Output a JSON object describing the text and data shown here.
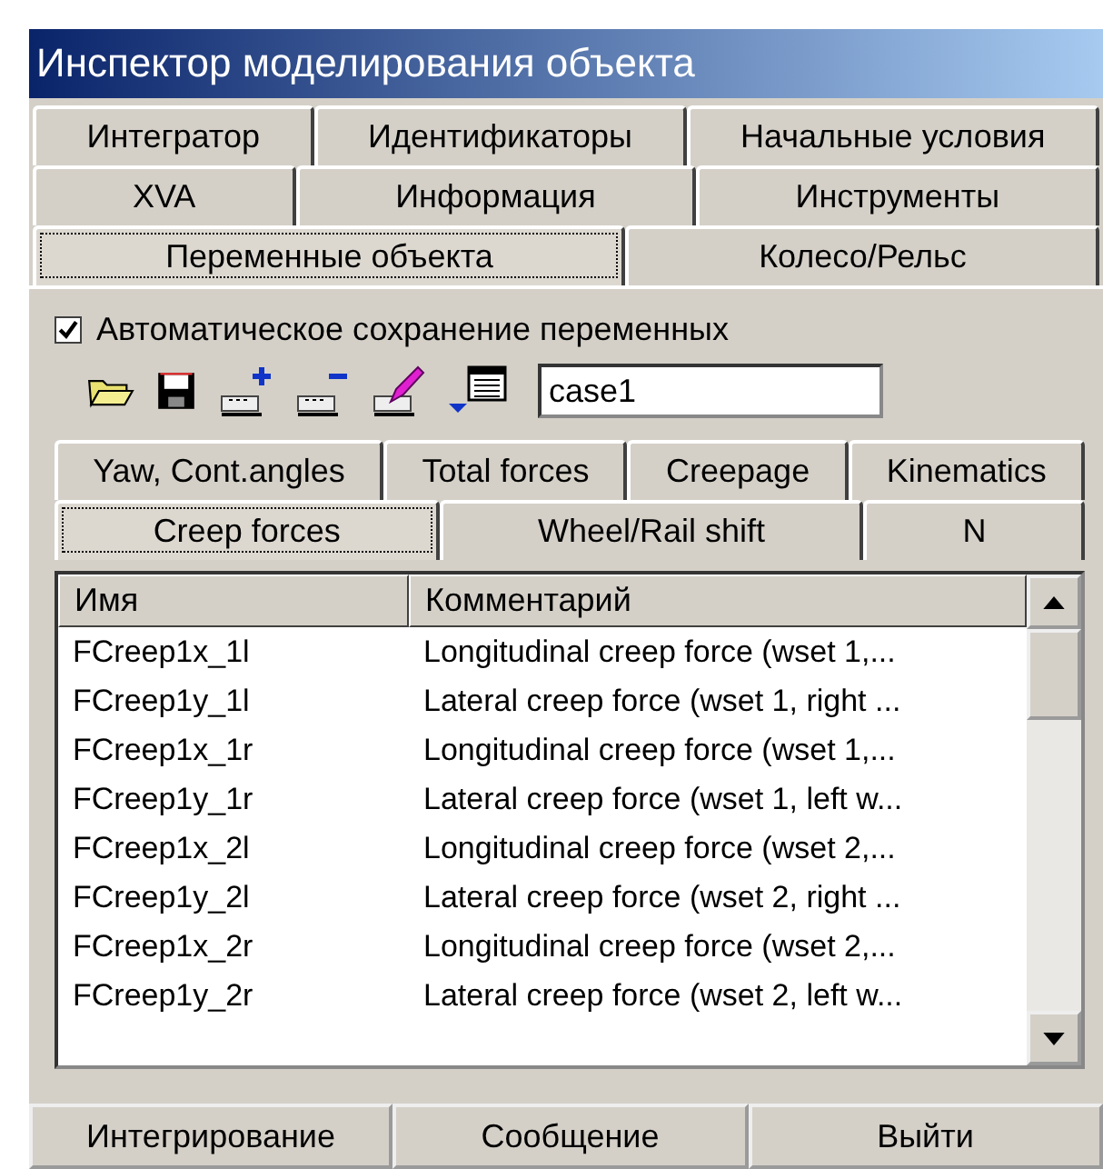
{
  "window": {
    "title": "Инспектор моделирования объекта"
  },
  "tab_rows": [
    [
      {
        "label": "Интегратор",
        "selected": false
      },
      {
        "label": "Идентификаторы",
        "selected": false
      },
      {
        "label": "Начальные условия",
        "selected": false
      }
    ],
    [
      {
        "label": "XVA",
        "selected": false
      },
      {
        "label": "Информация",
        "selected": false
      },
      {
        "label": "Инструменты",
        "selected": false
      }
    ],
    [
      {
        "label": "Переменные объекта",
        "selected": true
      },
      {
        "label": "Колесо/Рельс",
        "selected": false
      }
    ]
  ],
  "autosave": {
    "label": "Автоматическое сохранение переменных",
    "checked": true
  },
  "toolbar": {
    "buttons": [
      {
        "kind": "open"
      },
      {
        "kind": "save"
      },
      {
        "kind": "add"
      },
      {
        "kind": "remove"
      },
      {
        "kind": "edit"
      },
      {
        "kind": "list"
      }
    ],
    "name_field": {
      "value": "case1"
    }
  },
  "inner_tab_rows": [
    [
      {
        "label": "Yaw, Cont.angles",
        "selected": false
      },
      {
        "label": "Total forces",
        "selected": false
      },
      {
        "label": "Creepage",
        "selected": false
      },
      {
        "label": "Kinematics",
        "selected": false
      }
    ],
    [
      {
        "label": "Creep forces",
        "selected": true
      },
      {
        "label": "Wheel/Rail shift",
        "selected": false
      },
      {
        "label": "N",
        "selected": false
      }
    ]
  ],
  "table": {
    "columns": [
      "Имя",
      "Комментарий"
    ],
    "rows": [
      [
        "FCreep1x_1l",
        "Longitudinal creep force (wset 1,..."
      ],
      [
        "FCreep1y_1l",
        "Lateral creep force (wset 1, right ..."
      ],
      [
        "FCreep1x_1r",
        "Longitudinal creep force (wset 1,..."
      ],
      [
        "FCreep1y_1r",
        "Lateral creep force (wset 1, left w..."
      ],
      [
        "FCreep1x_2l",
        "Longitudinal creep force (wset 2,..."
      ],
      [
        "FCreep1y_2l",
        "Lateral creep force (wset 2, right ..."
      ],
      [
        "FCreep1x_2r",
        "Longitudinal creep force (wset 2,..."
      ],
      [
        "FCreep1y_2r",
        "Lateral creep force (wset 2, left w..."
      ]
    ]
  },
  "buttons": [
    "Интегрирование",
    "Сообщение",
    "Выйти"
  ]
}
